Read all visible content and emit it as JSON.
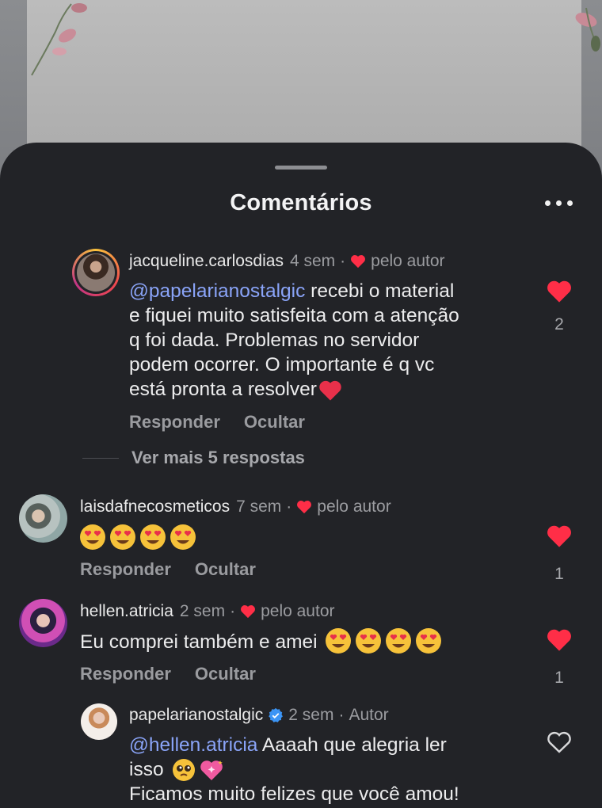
{
  "sheet": {
    "title": "Comentários",
    "more_icon": "more-horizontal-icon"
  },
  "colors": {
    "sheet_bg": "#222327",
    "heart": "#ff2e47",
    "mention": "#8aa4f8",
    "verified": "#3b94f5"
  },
  "comments": [
    {
      "username": "jacqueline.carlosdias",
      "time": "4 sem",
      "sep": "·",
      "liked_by_author": "pelo autor",
      "text_mention": "@papelarianostalgic",
      "text_lines": [
        " recebi o material",
        "e fiquei muito satisfeita com a atenção",
        "q foi dada. Problemas no servidor",
        "podem ocorrer. O importante é q vc",
        "está pronta a resolver"
      ],
      "reply_label": "Responder",
      "hide_label": "Ocultar",
      "likes": "2",
      "view_more": "Ver mais 5 respostas"
    },
    {
      "username": "laisdafnecosmeticos",
      "time": "7 sem",
      "sep": "·",
      "liked_by_author": "pelo autor",
      "emoji_count": 4,
      "reply_label": "Responder",
      "hide_label": "Ocultar",
      "likes": "1"
    },
    {
      "username": "hellen.atricia",
      "time": "2 sem",
      "sep": "·",
      "liked_by_author": "pelo autor",
      "text": "Eu comprei também e amei",
      "emoji_count": 4,
      "reply_label": "Responder",
      "hide_label": "Ocultar",
      "likes": "1"
    },
    {
      "username": "papelarianostalgic",
      "time": "2 sem",
      "sep": "·",
      "author_label": "Autor",
      "text_mention": "@hellen.atricia",
      "text_line1": " Aaaah que alegria ler",
      "text_line2": "isso",
      "text_line3": "Ficamos muito felizes que você amou!"
    }
  ]
}
